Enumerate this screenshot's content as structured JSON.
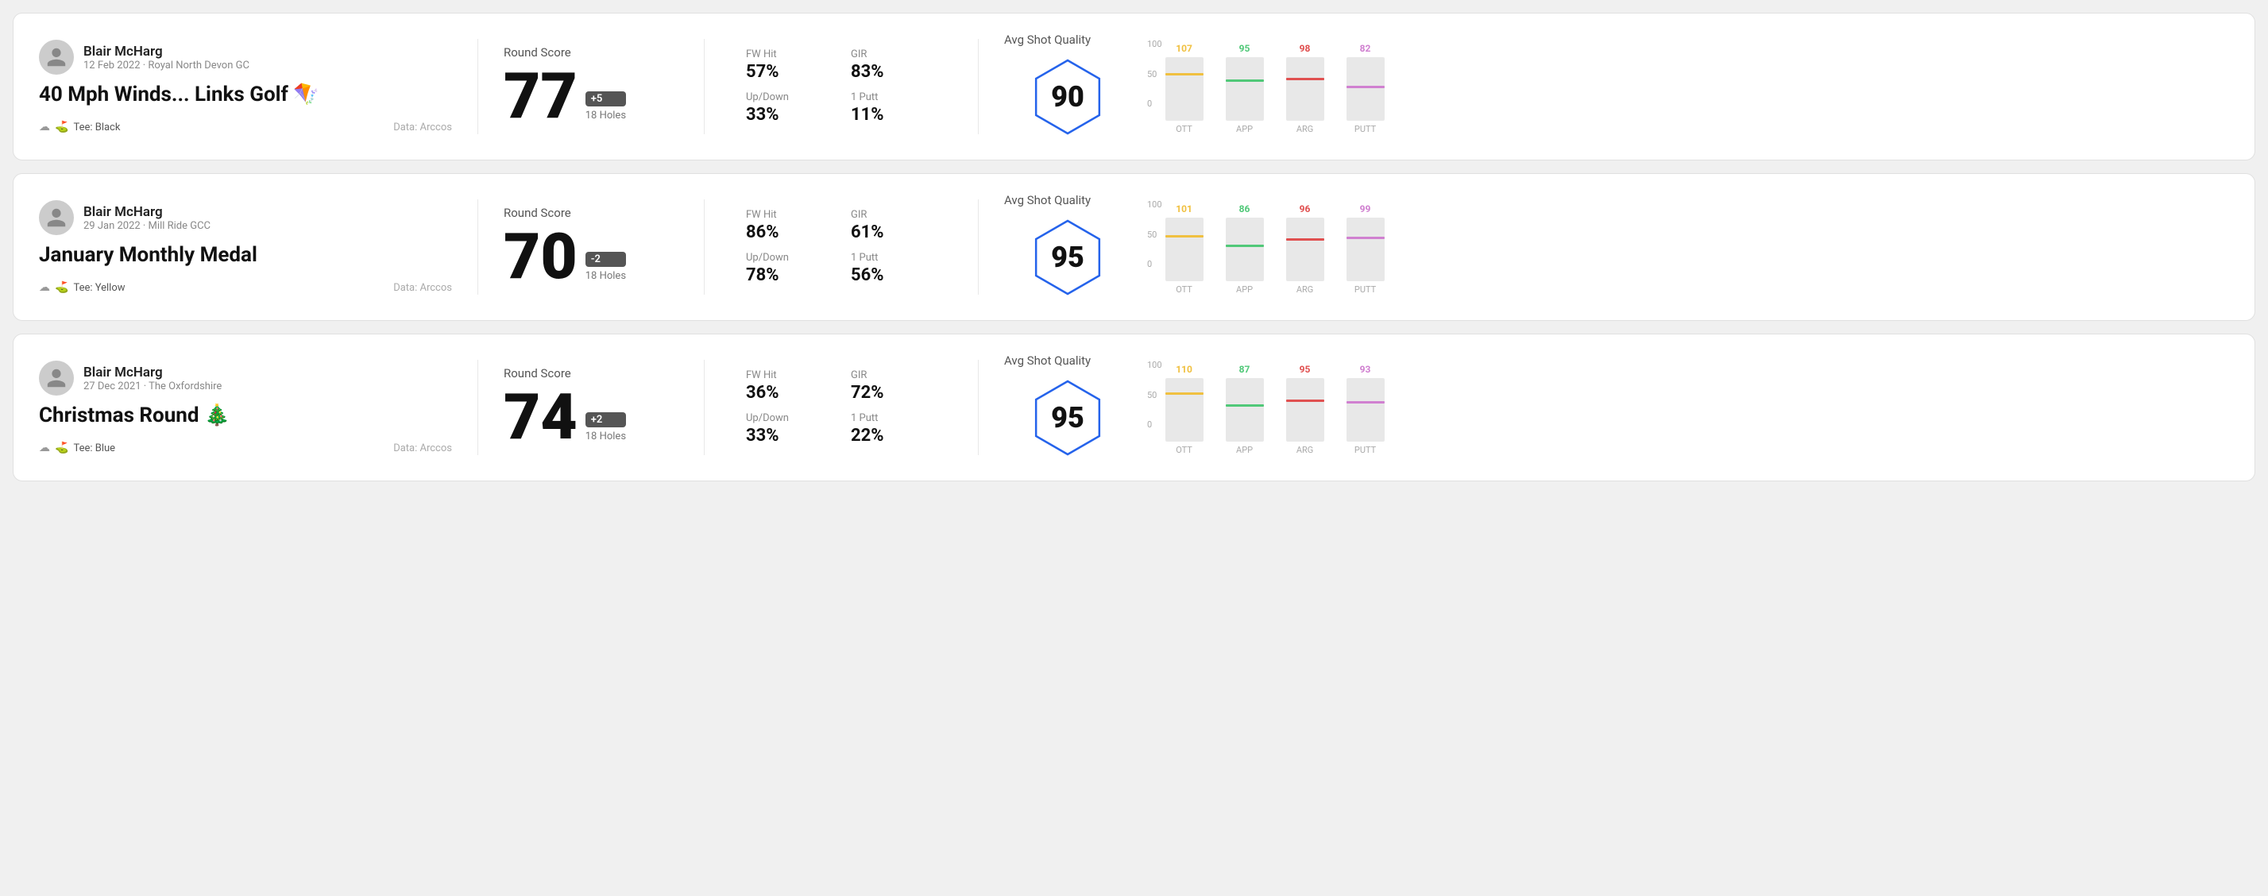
{
  "rounds": [
    {
      "id": "round1",
      "user": {
        "name": "Blair McHarg",
        "meta": "12 Feb 2022 · Royal North Devon GC"
      },
      "title": "40 Mph Winds... Links Golf 🪁",
      "tee": "Black",
      "dataSource": "Data: Arccos",
      "score": {
        "value": "77",
        "badge": "+5",
        "holes": "18 Holes"
      },
      "stats": {
        "fwHitLabel": "FW Hit",
        "fwHitValue": "57%",
        "girLabel": "GIR",
        "girValue": "83%",
        "upDownLabel": "Up/Down",
        "upDownValue": "33%",
        "onePuttLabel": "1 Putt",
        "onePuttValue": "11%"
      },
      "quality": {
        "label": "Avg Shot Quality",
        "score": "90"
      },
      "chart": {
        "bars": [
          {
            "label": "OTT",
            "value": 107,
            "color": "#f0c040",
            "pct": 75
          },
          {
            "label": "APP",
            "value": 95,
            "color": "#50c878",
            "pct": 65
          },
          {
            "label": "ARG",
            "value": 98,
            "color": "#e05050",
            "pct": 68
          },
          {
            "label": "PUTT",
            "value": 82,
            "color": "#d080d0",
            "pct": 55
          }
        ]
      }
    },
    {
      "id": "round2",
      "user": {
        "name": "Blair McHarg",
        "meta": "29 Jan 2022 · Mill Ride GCC"
      },
      "title": "January Monthly Medal",
      "tee": "Yellow",
      "dataSource": "Data: Arccos",
      "score": {
        "value": "70",
        "badge": "-2",
        "holes": "18 Holes"
      },
      "stats": {
        "fwHitLabel": "FW Hit",
        "fwHitValue": "86%",
        "girLabel": "GIR",
        "girValue": "61%",
        "upDownLabel": "Up/Down",
        "upDownValue": "78%",
        "onePuttLabel": "1 Putt",
        "onePuttValue": "56%"
      },
      "quality": {
        "label": "Avg Shot Quality",
        "score": "95"
      },
      "chart": {
        "bars": [
          {
            "label": "OTT",
            "value": 101,
            "color": "#f0c040",
            "pct": 72
          },
          {
            "label": "APP",
            "value": 86,
            "color": "#50c878",
            "pct": 58
          },
          {
            "label": "ARG",
            "value": 96,
            "color": "#e05050",
            "pct": 67
          },
          {
            "label": "PUTT",
            "value": 99,
            "color": "#d080d0",
            "pct": 70
          }
        ]
      }
    },
    {
      "id": "round3",
      "user": {
        "name": "Blair McHarg",
        "meta": "27 Dec 2021 · The Oxfordshire"
      },
      "title": "Christmas Round 🎄",
      "tee": "Blue",
      "dataSource": "Data: Arccos",
      "score": {
        "value": "74",
        "badge": "+2",
        "holes": "18 Holes"
      },
      "stats": {
        "fwHitLabel": "FW Hit",
        "fwHitValue": "36%",
        "girLabel": "GIR",
        "girValue": "72%",
        "upDownLabel": "Up/Down",
        "upDownValue": "33%",
        "onePuttLabel": "1 Putt",
        "onePuttValue": "22%"
      },
      "quality": {
        "label": "Avg Shot Quality",
        "score": "95"
      },
      "chart": {
        "bars": [
          {
            "label": "OTT",
            "value": 110,
            "color": "#f0c040",
            "pct": 78
          },
          {
            "label": "APP",
            "value": 87,
            "color": "#50c878",
            "pct": 59
          },
          {
            "label": "ARG",
            "value": 95,
            "color": "#e05050",
            "pct": 66
          },
          {
            "label": "PUTT",
            "value": 93,
            "color": "#d080d0",
            "pct": 64
          }
        ]
      }
    }
  ]
}
